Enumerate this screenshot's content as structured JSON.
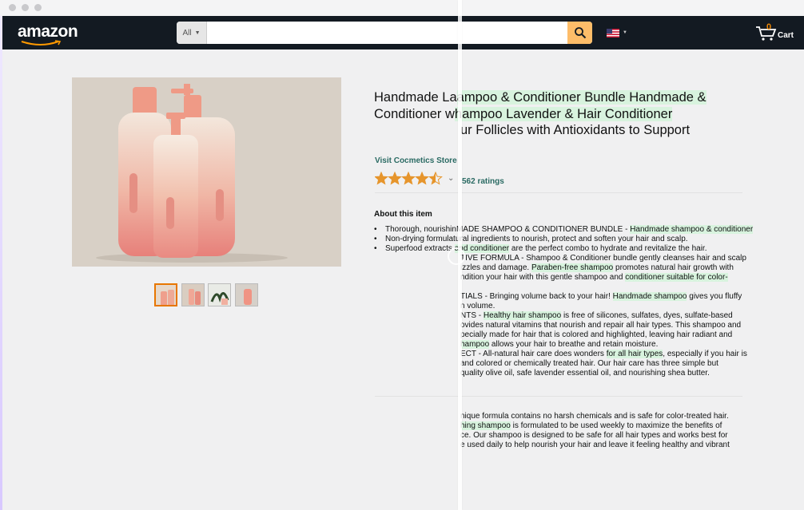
{
  "header": {
    "logo": "amazon",
    "search": {
      "category": "All",
      "placeholder": "",
      "value": ""
    },
    "cart": {
      "count": "0",
      "label": "Cart"
    }
  },
  "product": {
    "title_segments": [
      {
        "text": "Handmade La",
        "hl": false
      },
      {
        "text": "ampoo & Conditioner Bundle Handmade &",
        "hl": true
      },
      {
        "text": "Conditioner w",
        "hl": false,
        "br": true
      },
      {
        "text": "hampoo Lavender & ",
        "hl": true
      },
      {
        "text": "Hair Conditioner",
        "hl": true
      },
      {
        "text": "ur Follicles with Antioxidants to Support",
        "hl": false,
        "br": true,
        "indent": true
      }
    ],
    "store_link": "Visit Cocmetics Store",
    "rating_value": 4.5,
    "ratings_count": "562 ratings",
    "about_heading": "About this item",
    "thumbnails": [
      "bottles-thumb",
      "bottles-thumb-2",
      "plant-thumb",
      "product-thumb"
    ]
  },
  "bullets": [
    {
      "bullet": true,
      "segments": [
        {
          "t": "Thorough, nourishin",
          "hl": false
        },
        {
          "t": "MADE SHAMPOO & CONDITIONER BUNDLE - ",
          "hl": false
        },
        {
          "t": "Handmade shampoo & conditioner",
          "hl": true
        }
      ]
    },
    {
      "bullet": true,
      "segments": [
        {
          "t": "Non-drying formula",
          "hl": false
        },
        {
          "t": "tural ingredients to nourish, protect and soften your hair and scalp.",
          "hl": false
        }
      ]
    },
    {
      "bullet": true,
      "segments": [
        {
          "t": "Superfood extracts ",
          "hl": false
        },
        {
          "t": "and conditioner",
          "hl": true
        },
        {
          "t": " are the perfect combo to hydrate and revitalize the hair.",
          "hl": false
        }
      ]
    },
    {
      "bullet": false,
      "segments": [
        {
          "t": "TIVE FORMULA - Shampoo & Conditioner bundle gently cleanses hair and scalp",
          "hl": false
        }
      ]
    },
    {
      "bullet": false,
      "segments": [
        {
          "t": "izzles and damage. ",
          "hl": false
        },
        {
          "t": "Paraben-free shampoo",
          "hl": true
        },
        {
          "t": " promotes natural hair growth with",
          "hl": false
        }
      ]
    },
    {
      "bullet": false,
      "segments": [
        {
          "t": "ndition your hair with this gentle shampoo and ",
          "hl": false
        },
        {
          "t": "conditioner suitable for color-",
          "hl": true
        }
      ]
    },
    {
      "bullet": false,
      "segments": [
        {
          "t": "",
          "hl": false
        }
      ]
    },
    {
      "bullet": false,
      "segments": [
        {
          "t": "TIALS - Bringing volume back to your hair! ",
          "hl": false
        },
        {
          "t": "Handmade shampoo",
          "hl": true
        },
        {
          "t": " gives you fluffy",
          "hl": false
        }
      ]
    },
    {
      "bullet": false,
      "segments": [
        {
          "t": "n volume.",
          "hl": false
        }
      ]
    },
    {
      "bullet": false,
      "segments": [
        {
          "t": "NTS - ",
          "hl": false
        },
        {
          "t": "Healthy hair shampoo",
          "hl": true
        },
        {
          "t": " is free of silicones, sulfates, dyes, sulfate-based",
          "hl": false
        }
      ]
    },
    {
      "bullet": false,
      "segments": [
        {
          "t": "ovides natural vitamins that nourish and repair all hair types. This shampoo and",
          "hl": false
        }
      ]
    },
    {
      "bullet": false,
      "segments": [
        {
          "t": "pecially made for hair that is colored and highlighted, leaving hair radiant and",
          "hl": false
        }
      ]
    },
    {
      "bullet": false,
      "segments": [
        {
          "t": "hampoo",
          "hl": true
        },
        {
          "t": " allows your hair to breathe and retain moisture.",
          "hl": false
        }
      ]
    },
    {
      "bullet": false,
      "segments": [
        {
          "t": "ECT - All-natural hair care does wonders ",
          "hl": false
        },
        {
          "t": "for all hair types",
          "hl": true
        },
        {
          "t": ", especially if you hair is",
          "hl": false
        }
      ]
    },
    {
      "bullet": false,
      "segments": [
        {
          "t": "and colored or chemically treated hair. Our hair care has three simple but",
          "hl": false
        }
      ]
    },
    {
      "bullet": false,
      "segments": [
        {
          "t": "quality olive oil, safe lavender essential oil, and nourishing shea butter.",
          "hl": false
        }
      ]
    }
  ],
  "description": [
    {
      "segments": [
        {
          "t": "nique formula contains no harsh chemicals and is safe for color-treated hair.",
          "hl": false
        }
      ]
    },
    {
      "segments": [
        {
          "t": "hing shampoo",
          "hl": true
        },
        {
          "t": " is formulated to be used weekly to maximize the benefits of",
          "hl": false
        }
      ]
    },
    {
      "segments": [
        {
          "t": "ce. Our shampoo is designed to be safe for all hair types and works best for",
          "hl": false
        }
      ]
    },
    {
      "segments": [
        {
          "t": "e used daily to help nourish your hair and leave it feeling healthy and vibrant",
          "hl": false
        }
      ]
    }
  ],
  "colors": {
    "header_bg": "#131a22",
    "search_button": "#febd69",
    "link": "#2a6a63",
    "highlight": "#d8f3de",
    "star": "#e6952c"
  }
}
